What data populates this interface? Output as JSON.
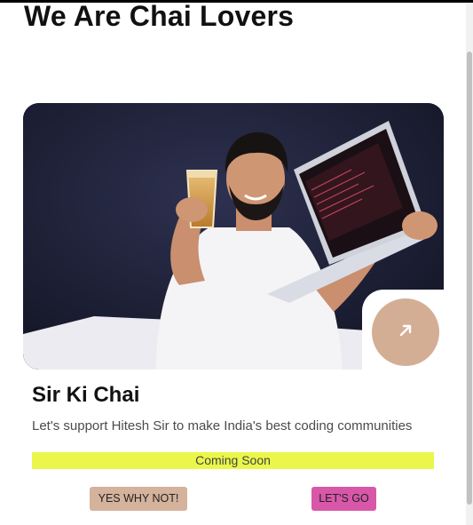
{
  "page": {
    "heading": "We Are Chai Lovers"
  },
  "card": {
    "image_alt": "Man holding a glass of chai and a laptop",
    "arrow_icon": "arrow-up-right-icon",
    "title": "Sir Ki Chai",
    "description": "Let's support Hitesh Sir to make India's best coding communities",
    "status": "Coming Soon",
    "buttons": {
      "yes_label": "YES WHY NOT!",
      "go_label": "LET'S GO"
    }
  },
  "colors": {
    "arrow_button": "#d3ae95",
    "status_banner": "#eaf74a",
    "yes_button": "#d4b29b",
    "go_button": "#d857a8"
  }
}
